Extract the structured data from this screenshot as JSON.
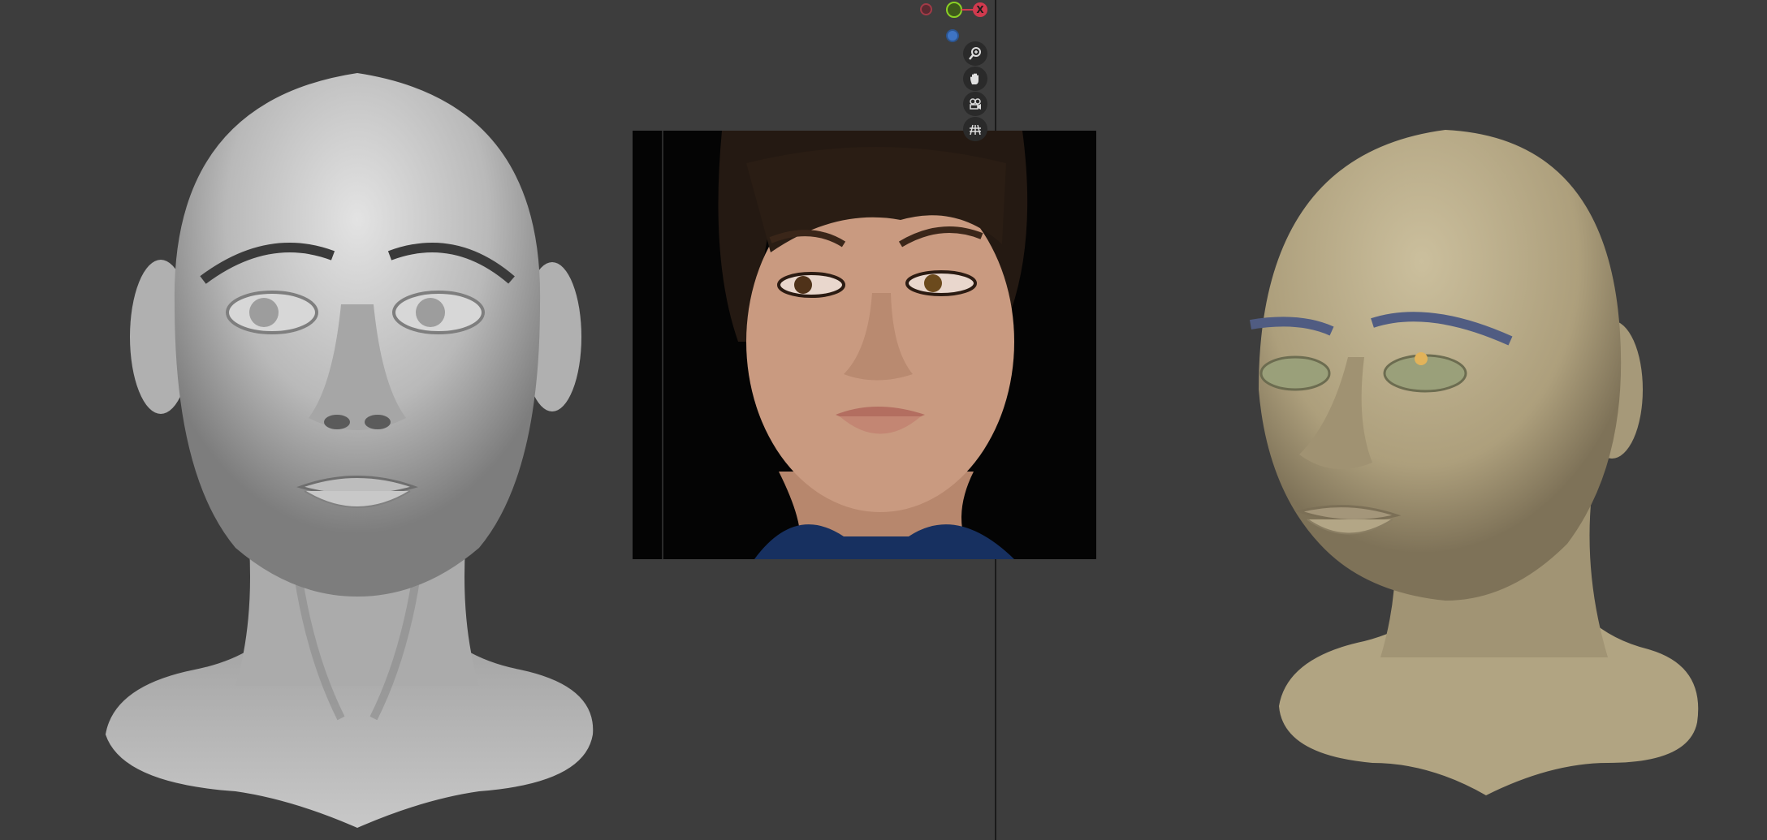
{
  "viewport_left": {
    "top_label": ""
  },
  "gizmo": {
    "x_label": "X"
  },
  "nav_buttons": [
    "zoom-icon",
    "hand-pan-icon",
    "camera-icon",
    "grid-icon"
  ],
  "colors": {
    "background": "#3d3d3d",
    "separator": "#1a1a1a",
    "axis_x": "#d13a4e",
    "axis_y": "#3e74c4",
    "axis_z": "#8bd124",
    "left_head": "#bdbdbd",
    "right_head": "#b3a684"
  }
}
